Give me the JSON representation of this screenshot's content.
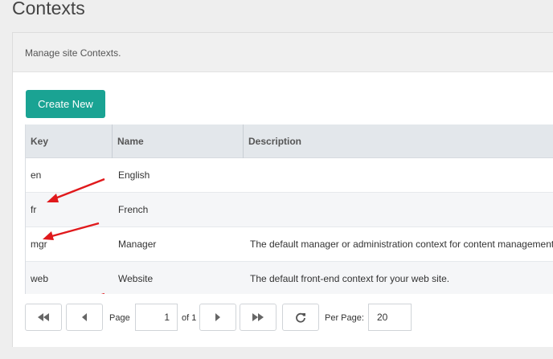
{
  "page": {
    "title": "Contexts",
    "description": "Manage site Contexts."
  },
  "toolbar": {
    "create_label": "Create New"
  },
  "grid": {
    "columns": [
      "Key",
      "Name",
      "Description"
    ],
    "rows": [
      {
        "key": "en",
        "name": "English",
        "description": ""
      },
      {
        "key": "fr",
        "name": "French",
        "description": ""
      },
      {
        "key": "mgr",
        "name": "Manager",
        "description": "The default manager or administration context for content management activity."
      },
      {
        "key": "web",
        "name": "Website",
        "description": "The default front-end context for your web site."
      }
    ]
  },
  "pager": {
    "page_label": "Page",
    "current_page": "1",
    "of_label": "of 1",
    "per_page_label": "Per Page:",
    "per_page": "20"
  },
  "icons": {
    "first": "double-chevron-left-icon",
    "prev": "chevron-left-icon",
    "next": "chevron-right-icon",
    "last": "double-chevron-right-icon",
    "refresh": "refresh-icon",
    "annotation": "red-arrow-icon"
  },
  "colors": {
    "accent": "#1aa393",
    "annotation": "#e0191c"
  }
}
